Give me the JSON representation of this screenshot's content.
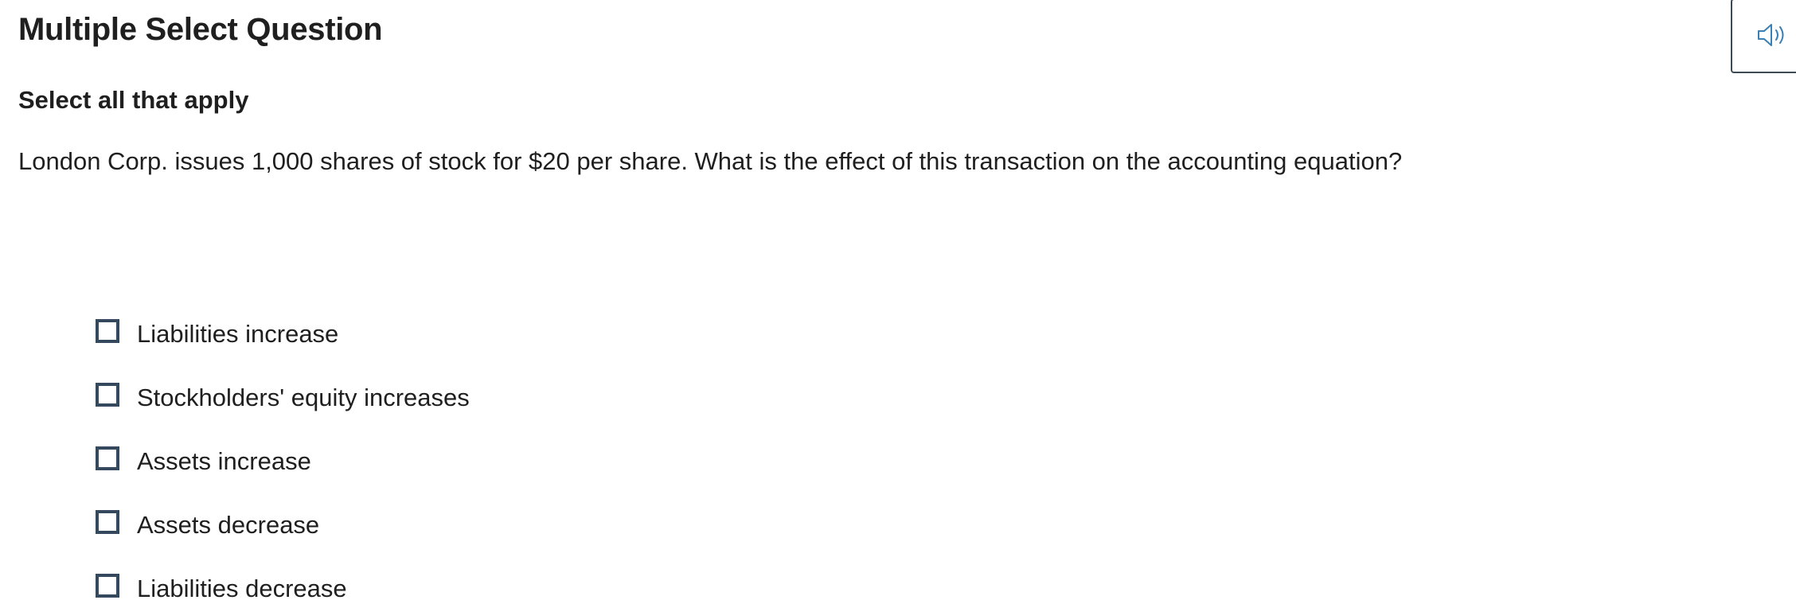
{
  "header": {
    "question_type": "Multiple Select Question",
    "instruction": "Select all that apply",
    "audio_icon": "speaker-icon"
  },
  "question": {
    "prompt": "London Corp. issues 1,000 shares of stock for $20 per share. What is the effect of this transaction on the accounting equation?"
  },
  "options": [
    {
      "label": "Liabilities increase",
      "checked": false
    },
    {
      "label": "Stockholders' equity increases",
      "checked": false
    },
    {
      "label": "Assets increase",
      "checked": false
    },
    {
      "label": "Assets decrease",
      "checked": false
    },
    {
      "label": "Liabilities decrease",
      "checked": false
    }
  ],
  "colors": {
    "checkbox_border": "#34495e",
    "text": "#1f1f1f",
    "audio_icon": "#3a7fb5"
  }
}
